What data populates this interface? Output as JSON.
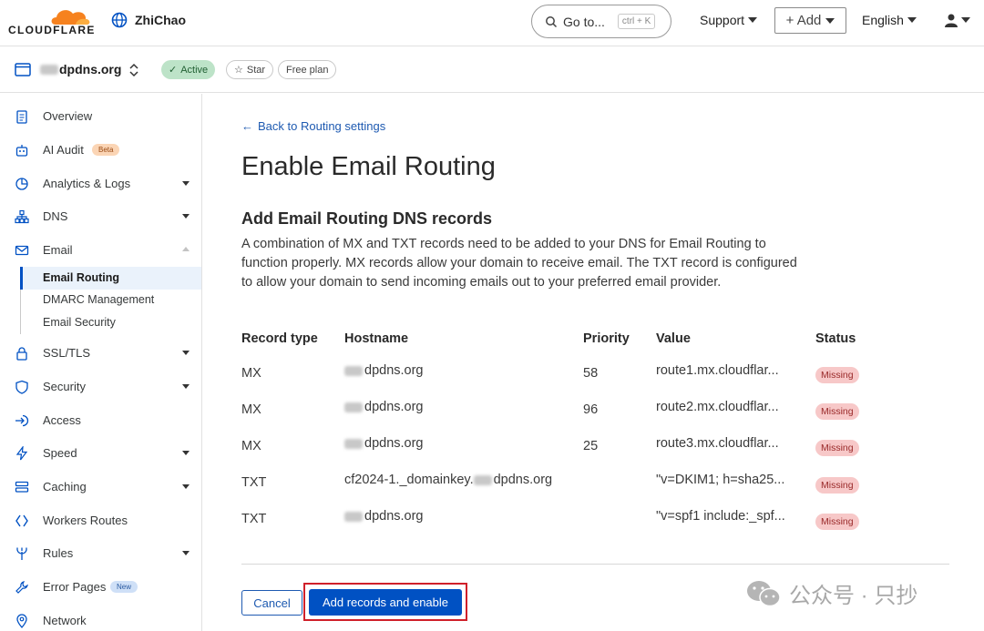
{
  "header": {
    "logo_text": "CLOUDFLARE",
    "account_name": "ZhiChao",
    "goto_label": "Go to...",
    "goto_shortcut": "ctrl + K",
    "support_label": "Support",
    "add_label": "+ Add",
    "language_label": "English"
  },
  "zone": {
    "name": "dpdns.org",
    "status": "Active",
    "star_label": "Star",
    "plan": "Free plan"
  },
  "sidebar": {
    "items": [
      {
        "label": "Overview"
      },
      {
        "label": "AI Audit",
        "badge": "Beta"
      },
      {
        "label": "Analytics & Logs"
      },
      {
        "label": "DNS"
      },
      {
        "label": "Email"
      },
      {
        "label": "SSL/TLS"
      },
      {
        "label": "Security"
      },
      {
        "label": "Access"
      },
      {
        "label": "Speed"
      },
      {
        "label": "Caching"
      },
      {
        "label": "Workers Routes"
      },
      {
        "label": "Rules"
      },
      {
        "label": "Error Pages",
        "badge": "New"
      },
      {
        "label": "Network"
      }
    ],
    "email_sub": [
      "Email Routing",
      "DMARC Management",
      "Email Security"
    ]
  },
  "main": {
    "back_link": "Back to Routing settings",
    "title": "Enable Email Routing",
    "section_title": "Add Email Routing DNS records",
    "description": "A combination of MX and TXT records need to be added to your DNS for Email Routing to function properly. MX records allow your domain to receive email. The TXT record is configured to allow your domain to send incoming emails out to your preferred email provider.",
    "table": {
      "headers": [
        "Record type",
        "Hostname",
        "Priority",
        "Value",
        "Status"
      ],
      "rows": [
        {
          "type": "MX",
          "hostname": "dpdns.org",
          "priority": "58",
          "value": "route1.mx.cloudflar...",
          "status": "Missing"
        },
        {
          "type": "MX",
          "hostname": "dpdns.org",
          "priority": "96",
          "value": "route2.mx.cloudflar...",
          "status": "Missing"
        },
        {
          "type": "MX",
          "hostname": "dpdns.org",
          "priority": "25",
          "value": "route3.mx.cloudflar...",
          "status": "Missing"
        },
        {
          "type": "TXT",
          "hostname_prefix": "cf2024-1._domainkey.",
          "hostname": "dpdns.org",
          "priority": "",
          "value": "\"v=DKIM1; h=sha25...",
          "status": "Missing"
        },
        {
          "type": "TXT",
          "hostname": "dpdns.org",
          "priority": "",
          "value": "\"v=spf1 include:_spf...",
          "status": "Missing"
        }
      ]
    },
    "cancel_label": "Cancel",
    "submit_label": "Add records and enable"
  },
  "watermark": "公众号 · 只抄",
  "colors": {
    "accent": "#0051c3",
    "orange": "#f6821f",
    "missing_bg": "#f7c8c8",
    "highlight": "#d0202a"
  }
}
